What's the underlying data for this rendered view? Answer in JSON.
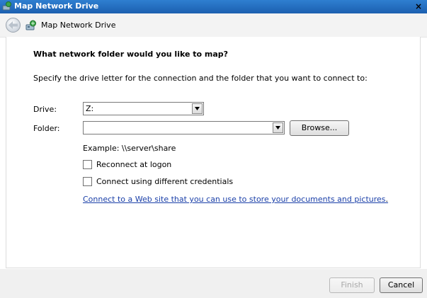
{
  "window": {
    "title": "Map Network Drive",
    "close_glyph": "×"
  },
  "header": {
    "title": "Map Network Drive",
    "back_icon": "back-arrow-icon",
    "network_drive_icon": "network-drive-icon"
  },
  "main": {
    "heading": "What network folder would you like to map?",
    "instruction": "Specify the drive letter for the connection and the folder that you want to connect to:",
    "drive": {
      "label": "Drive:",
      "value": "Z:"
    },
    "folder": {
      "label": "Folder:",
      "value": "",
      "browse_label": "Browse..."
    },
    "example": "Example: \\\\server\\share",
    "reconnect": {
      "label": "Reconnect at logon",
      "checked": false
    },
    "credentials": {
      "label": "Connect using different credentials",
      "checked": false
    },
    "link": {
      "text": "Connect to a Web site that you can use to store your documents and pictures",
      "suffix": "."
    }
  },
  "footer": {
    "finish_label": "Finish",
    "cancel_label": "Cancel"
  },
  "colors": {
    "titlebar": "#1c5fb0",
    "link": "#1a3fa8"
  }
}
